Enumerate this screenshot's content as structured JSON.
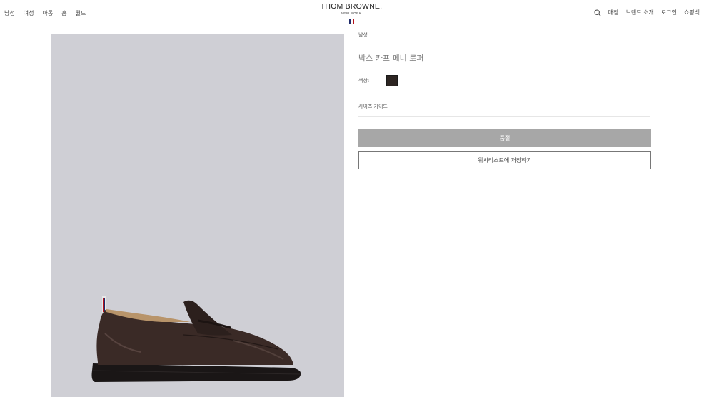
{
  "header": {
    "nav_left": [
      "남성",
      "여성",
      "아동",
      "홈",
      "월드"
    ],
    "logo_main": "THOM BROWNE.",
    "logo_sub": "NEW YORK",
    "flag_colors": [
      "#1f2b6b",
      "#ffffff",
      "#b5121b"
    ],
    "search_icon": "search-icon",
    "nav_right": [
      "매장",
      "브랜드 소개",
      "로그인",
      "쇼핑백"
    ]
  },
  "product": {
    "category": "남성",
    "name": "박스 카프 페니 로퍼",
    "color_label": "색상:",
    "color_swatch": "#2d2522",
    "size_guide": "사이즈 가이드",
    "soldout_label": "품절",
    "wishlist_label": "위시리스트에 저장하기",
    "image_bg": "#cfcfd5"
  }
}
